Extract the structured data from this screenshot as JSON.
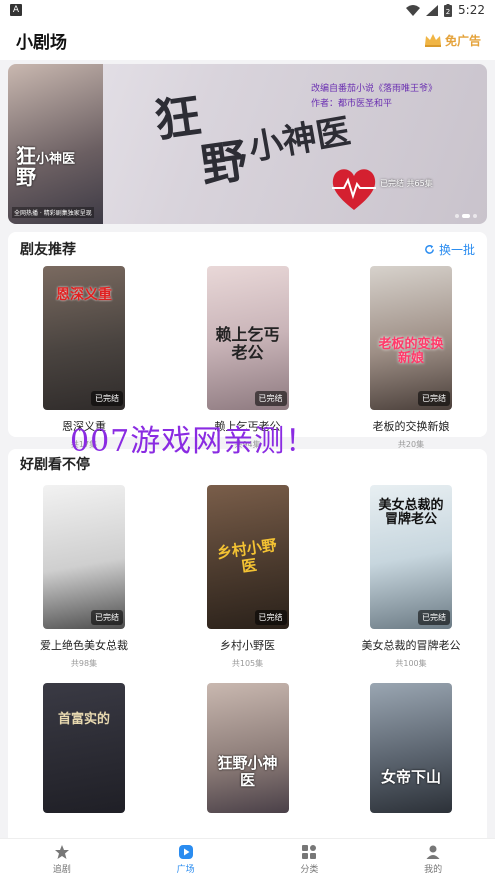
{
  "status": {
    "left_icon": "A",
    "time": "5:22",
    "battery": "2"
  },
  "header": {
    "title": "小剧场",
    "ad_free": "免广告"
  },
  "banner": {
    "poster_title": "狂\n小神医\n野",
    "poster_sub": "全网热播 · 精彩剧集独家呈现",
    "big_a": "狂",
    "big_b": "野",
    "big_mid": "小神医",
    "info_line1": "改编自番茄小说《落雨唯王爷》",
    "info_line2": "作者：都市医圣和平",
    "episodes": "已完结 共65集"
  },
  "recommend": {
    "title": "剧友推荐",
    "refresh": "换一批",
    "items": [
      {
        "poster_text": "恩深义重",
        "name": "恩深义重",
        "eps": "共17集",
        "done": "已完结"
      },
      {
        "poster_text": "赖上乞丐老公",
        "name": "赖上乞丐老公",
        "eps": "共94集",
        "done": "已完结"
      },
      {
        "poster_text": "老板的变换新娘",
        "name": "老板的交换新娘",
        "eps": "共20集",
        "done": "已完结"
      }
    ]
  },
  "good": {
    "title": "好剧看不停",
    "items": [
      {
        "name": "爱上绝色美女总裁",
        "eps": "共98集",
        "done": "已完结",
        "poster_text": ""
      },
      {
        "name": "乡村小野医",
        "eps": "共105集",
        "done": "已完结",
        "poster_text": "乡村小野医"
      },
      {
        "name": "美女总裁的冒牌老公",
        "eps": "共100集",
        "done": "已完结",
        "poster_text": "美女总裁的冒牌老公"
      },
      {
        "poster_text": "首富实的",
        "done": ""
      },
      {
        "poster_text": "狂野小神医",
        "done": ""
      },
      {
        "poster_text": "女帝下山",
        "done": ""
      }
    ]
  },
  "watermark": "007游戏网亲测！",
  "tabs": [
    {
      "label": "追剧",
      "icon": "star-icon"
    },
    {
      "label": "广场",
      "icon": "play-icon"
    },
    {
      "label": "分类",
      "icon": "grid-icon"
    },
    {
      "label": "我的",
      "icon": "person-icon"
    }
  ],
  "colors": {
    "accent": "#2a8cf0",
    "gold": "#e4a23a",
    "watermark": "#8a2be2"
  }
}
